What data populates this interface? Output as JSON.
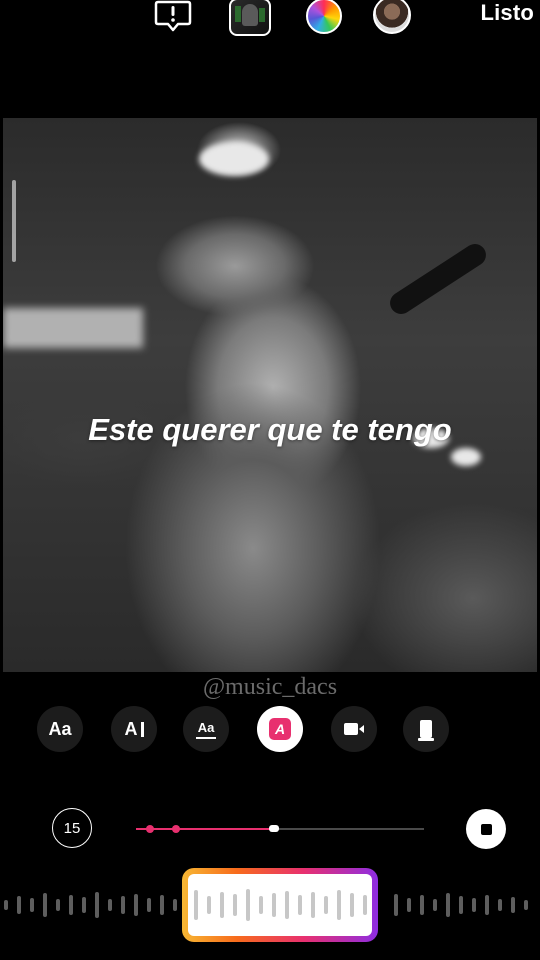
{
  "topbar": {
    "icons": [
      "alert-bubble-icon",
      "music-cover-thumbnail",
      "color-wheel-icon",
      "profile-avatar"
    ],
    "done_label": "Listo"
  },
  "canvas": {
    "lyric_text": "Este querer que te tengo",
    "watermark": "@music_dacs"
  },
  "text_styles": [
    {
      "name": "font-style",
      "label": "Aa"
    },
    {
      "name": "typewriter-style",
      "label": "A"
    },
    {
      "name": "underline-style",
      "label": "Aa"
    },
    {
      "name": "highlight-style",
      "label": "A",
      "active": true
    },
    {
      "name": "video-style",
      "icon": "camera-icon"
    },
    {
      "name": "card-style",
      "icon": "card-icon"
    }
  ],
  "timeline": {
    "duration": "15",
    "progress": 0.48,
    "markers": [
      0.05,
      0.14
    ],
    "accent": "#e8306f"
  },
  "colors": {
    "accent_pink": "#e8306f",
    "background": "#000000"
  }
}
